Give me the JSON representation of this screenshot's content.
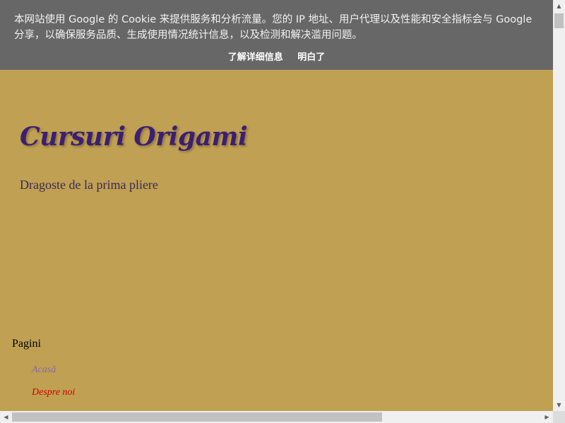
{
  "cookie_banner": {
    "message": "本网站使用 Google 的 Cookie 来提供服务和分析流量。您的 IP 地址、用户代理以及性能和安全指标会与 Google 分享，以确保服务品质、生成使用情况统计信息，以及检测和解决滥用问题。",
    "learn_more_label": "了解详细信息",
    "ok_label": "明白了"
  },
  "header": {
    "title": "Cursuri Origami",
    "description": "Dragoste de la prima pliere"
  },
  "pages_widget": {
    "title": "Pagini",
    "items": [
      {
        "label": "Acasă"
      },
      {
        "label": "Despre noi"
      }
    ]
  },
  "scrollbars": {
    "up_icon": "▲",
    "down_icon": "▼",
    "left_icon": "◀",
    "right_icon": "▶"
  },
  "colors": {
    "page_background": "#c0a052",
    "banner_background": "#676767",
    "title_color": "#3b1f74",
    "home_link_color": "#7e6aa8",
    "about_link_color": "#d10000"
  }
}
